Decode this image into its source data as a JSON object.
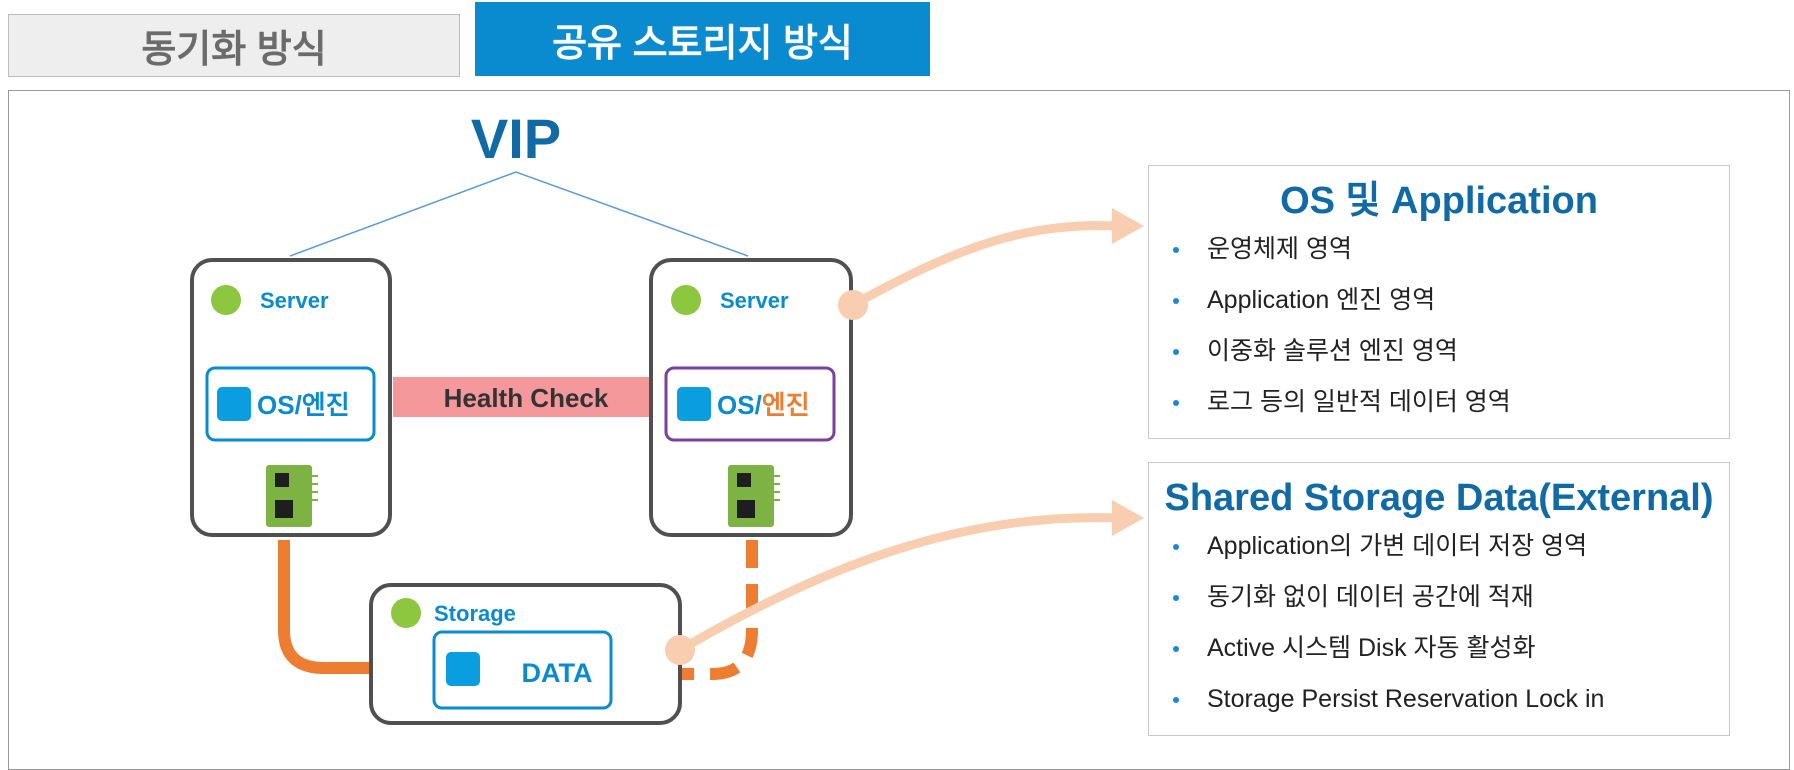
{
  "tabs": [
    {
      "label": "동기화 방식",
      "active": false
    },
    {
      "label": "공유 스토리지 방식",
      "active": true
    }
  ],
  "diagram": {
    "vip_label": "VIP",
    "server_left": {
      "title": "Server",
      "module_label": "OS/엔진"
    },
    "server_right": {
      "title": "Server",
      "module_prefix": "OS/",
      "module_suffix": "엔진"
    },
    "health_check_label": "Health Check",
    "storage": {
      "title": "Storage",
      "data_label": "DATA"
    },
    "colors": {
      "accent_blue": "#0a8bd0",
      "title_blue": "#0f6aa5",
      "green_dot": "#8dc63f",
      "orange_link": "#ed7d31",
      "health_band": "#f4989c",
      "peach_arrow": "#f8cdb0",
      "purple_border": "#7b3fa0",
      "server_border": "#505050"
    }
  },
  "info_os": {
    "title": "OS 및 Application",
    "items": [
      "운영체제 영역",
      "Application 엔진 영역",
      "이중화 솔루션 엔진 영역",
      "로그 등의 일반적 데이터 영역"
    ]
  },
  "info_storage": {
    "title": "Shared Storage Data(External)",
    "items": [
      "Application의 가변 데이터 저장 영역",
      "동기화 없이 데이터 공간에 적재",
      "Active 시스템 Disk 자동 활성화",
      "Storage Persist Reservation Lock in"
    ]
  }
}
